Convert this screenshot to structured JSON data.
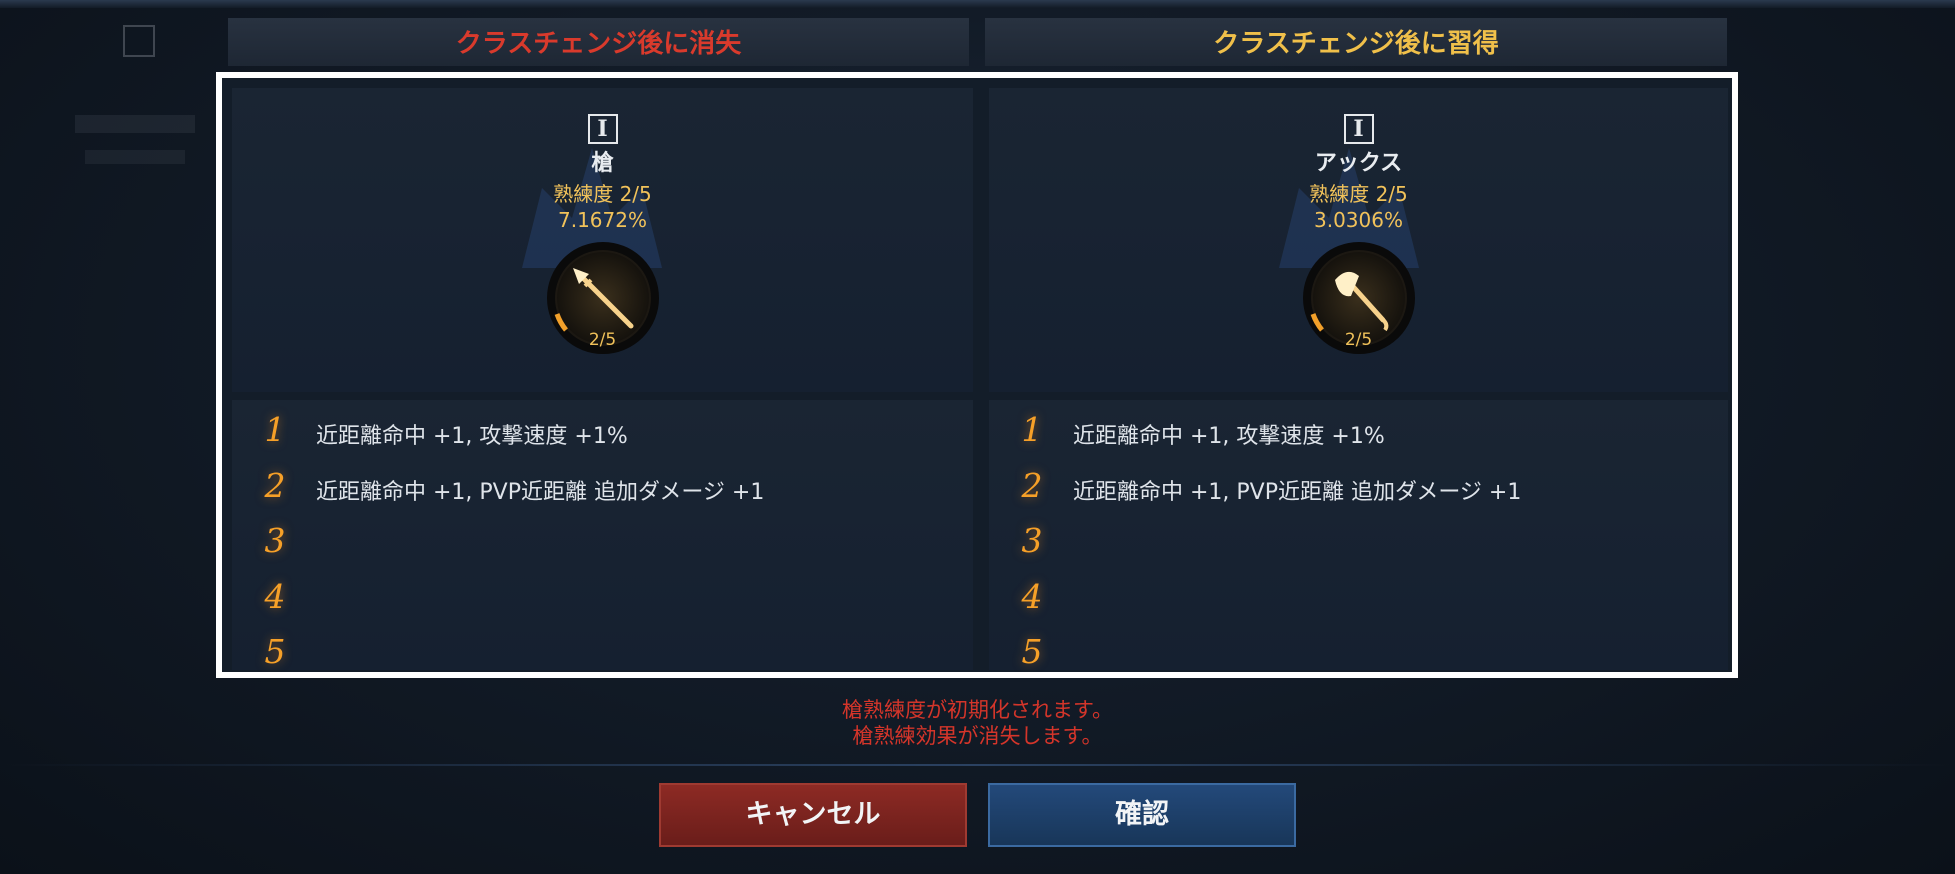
{
  "headers": {
    "lost": "クラスチェンジ後に消失",
    "gained": "クラスチェンジ後に習得"
  },
  "left_weapon": {
    "tier": "I",
    "name": "槍",
    "proficiency": "熟練度 2/5",
    "percent": "7.1672%",
    "level": "2/5",
    "progress": 0.4,
    "icon": "spear-icon"
  },
  "right_weapon": {
    "tier": "I",
    "name": "アックス",
    "proficiency": "熟練度 2/5",
    "percent": "3.0306%",
    "level": "2/5",
    "progress": 0.4,
    "icon": "axe-icon"
  },
  "left_effects": [
    {
      "num": "1",
      "text": "近距離命中 +1, 攻撃速度 +1%"
    },
    {
      "num": "2",
      "text": "近距離命中 +1, PVP近距離 追加ダメージ +1"
    },
    {
      "num": "3",
      "text": ""
    },
    {
      "num": "4",
      "text": ""
    },
    {
      "num": "5",
      "text": ""
    }
  ],
  "right_effects": [
    {
      "num": "1",
      "text": "近距離命中 +1, 攻撃速度 +1%"
    },
    {
      "num": "2",
      "text": "近距離命中 +1, PVP近距離 追加ダメージ +1"
    },
    {
      "num": "3",
      "text": ""
    },
    {
      "num": "4",
      "text": ""
    },
    {
      "num": "5",
      "text": ""
    }
  ],
  "notice": {
    "line1": "槍熟練度が初期化されます。",
    "line2": "槍熟練効果が消失します。"
  },
  "buttons": {
    "cancel": "キャンセル",
    "confirm": "確認"
  },
  "colors": {
    "lost_header": "#d93a2c",
    "gained_header": "#f0c04a",
    "accent_gold": "#f1c25a",
    "number_orange": "#f6a028"
  }
}
